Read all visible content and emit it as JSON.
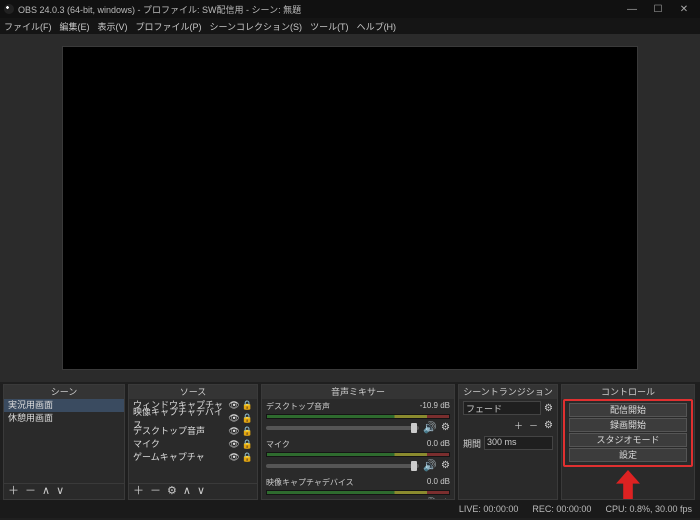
{
  "window": {
    "title": "OBS 24.0.3 (64-bit, windows) - プロファイル: SW配信用 - シーン: 無題"
  },
  "menu": {
    "file": "ファイル(F)",
    "edit": "編集(E)",
    "view": "表示(V)",
    "profile": "プロファイル(P)",
    "scene_collection": "シーンコレクション(S)",
    "tools": "ツール(T)",
    "help": "ヘルプ(H)"
  },
  "panels": {
    "scenes": {
      "title": "シーン",
      "items": [
        "実況用画面",
        "休憩用画面"
      ]
    },
    "sources": {
      "title": "ソース",
      "items": [
        "ウィンドウキャプチャ",
        "映像キャプチャデバイス",
        "デスクトップ音声",
        "マイク",
        "ゲームキャプチャ"
      ]
    },
    "mixer": {
      "title": "音声ミキサー",
      "channels": [
        {
          "name": "デスクトップ音声",
          "db": "-10.9 dB"
        },
        {
          "name": "マイク",
          "db": "0.0 dB"
        },
        {
          "name": "映像キャプチャデバイス",
          "db": "0.0 dB"
        }
      ]
    },
    "transitions": {
      "title": "シーントランジション",
      "selected": "フェード",
      "duration_label": "期間",
      "duration_value": "300 ms"
    },
    "controls": {
      "title": "コントロール",
      "buttons": {
        "stream": "配信開始",
        "record": "録画開始",
        "studio": "スタジオモード",
        "settings": "設定"
      }
    }
  },
  "status": {
    "live": "LIVE: 00:00:00",
    "rec": "REC: 00:00:00",
    "cpu": "CPU: 0.8%, 30.00 fps"
  }
}
